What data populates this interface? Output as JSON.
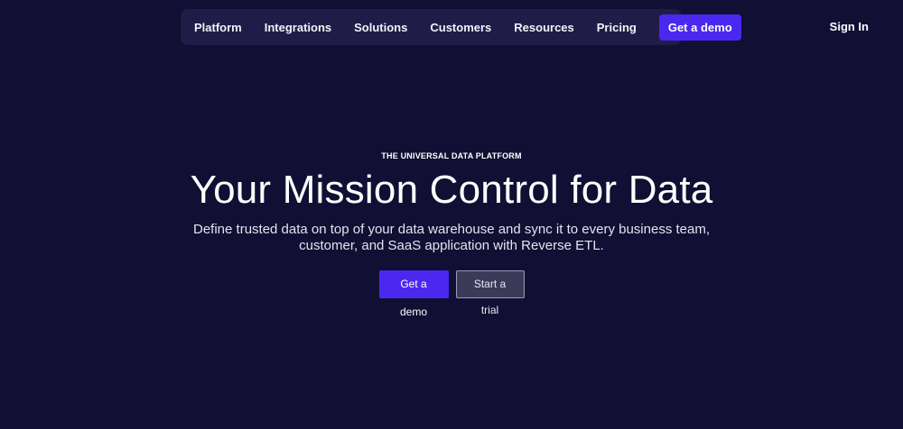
{
  "nav": {
    "items": [
      {
        "label": "Platform"
      },
      {
        "label": "Integrations"
      },
      {
        "label": "Solutions"
      },
      {
        "label": "Customers"
      },
      {
        "label": "Resources"
      },
      {
        "label": "Pricing"
      }
    ],
    "cta_label": "Get a demo",
    "sign_in_label": "Sign In"
  },
  "hero": {
    "eyebrow": "THE UNIVERSAL DATA PLATFORM",
    "headline": "Your Mission Control for Data",
    "subhead": "Define trusted data on top of your data warehouse and sync it to every business team, customer, and SaaS application with Reverse ETL.",
    "primary_cta": "Get a demo",
    "secondary_cta": "Start a trial"
  },
  "colors": {
    "background": "#110f33",
    "nav_background": "#1f1d48",
    "accent": "#4b28f0"
  }
}
